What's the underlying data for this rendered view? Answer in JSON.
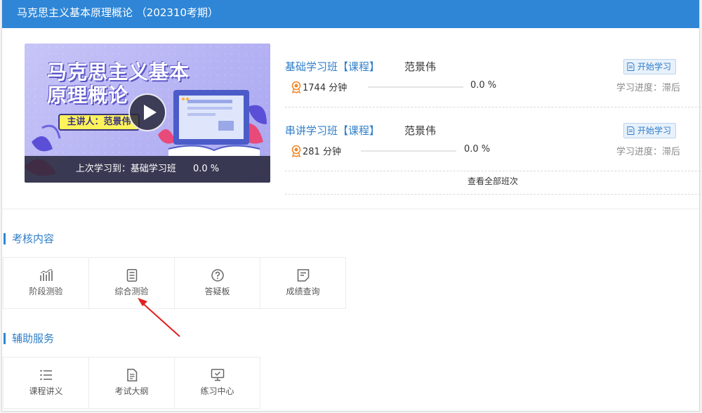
{
  "header": {
    "title": "马克思主义基本原理概论 （202310考期）"
  },
  "cover": {
    "title_line1": "马克思主义基本",
    "title_line2": "原理概论",
    "teacher_tag": "主讲人：范景伟",
    "last_study_label": "上次学习到：基础学习班",
    "last_study_progress": "0.0 %"
  },
  "classes": [
    {
      "name": "基础学习班【课程】",
      "teacher": "范景伟",
      "minutes": "1744 分钟",
      "progress": 0.0,
      "progress_text": "0.0 %",
      "button": "开始学习",
      "status": "学习进度：滞后"
    },
    {
      "name": "串讲学习班【课程】",
      "teacher": "范景伟",
      "minutes": "281 分钟",
      "progress": 0.0,
      "progress_text": "0.0 %",
      "button": "开始学习",
      "status": "学习进度：滞后"
    }
  ],
  "view_all": "查看全部班次",
  "assessment": {
    "title": "考核内容",
    "items": [
      {
        "label": "阶段测验",
        "icon": "bar-chart-icon"
      },
      {
        "label": "综合测验",
        "icon": "document-icon"
      },
      {
        "label": "答疑板",
        "icon": "question-icon"
      },
      {
        "label": "成绩查询",
        "icon": "note-icon"
      }
    ]
  },
  "services": {
    "title": "辅助服务",
    "items": [
      {
        "label": "课程讲义",
        "icon": "list-icon"
      },
      {
        "label": "考试大纲",
        "icon": "file-icon"
      },
      {
        "label": "练习中心",
        "icon": "monitor-check-icon"
      }
    ]
  },
  "colors": {
    "header": "#2f86d6",
    "link": "#2f7ec9",
    "arrow": "#e02020"
  }
}
